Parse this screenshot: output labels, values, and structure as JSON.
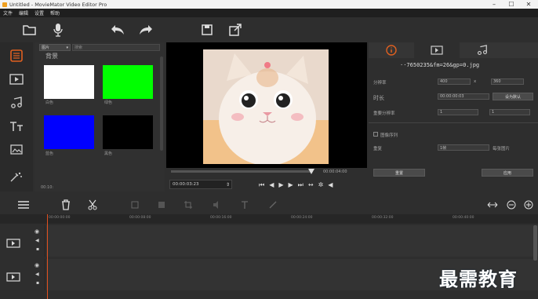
{
  "window": {
    "title": "Untitled - MovieMator Video Editor Pro",
    "controls": [
      "–",
      "☐",
      "✕"
    ]
  },
  "menu": [
    "文件",
    "编辑",
    "设置",
    "帮助"
  ],
  "library": {
    "type_select": "图片",
    "search_placeholder": "搜索",
    "category": "背景",
    "swatches": [
      {
        "label": "白色",
        "color": "#ffffff"
      },
      {
        "label": "绿色",
        "color": "#00ff00"
      },
      {
        "label": "蓝色",
        "color": "#0000ff"
      },
      {
        "label": "黑色",
        "color": "#000000"
      }
    ],
    "bottom_label": "00:10:"
  },
  "preview": {
    "total_time": "00:00:04:00",
    "current_time": "00:00:03:23"
  },
  "properties": {
    "filename": "··7650235&fm=26&gp=0.jpg",
    "resolution_label": "分辨率",
    "res_w": "400",
    "res_x": "x",
    "res_h": "360",
    "duration_label": "时长",
    "duration": "00:00:00:03",
    "set_default": "设为默认",
    "target_res_label": "重要分辨率",
    "target_a": "1",
    "target_b": "1",
    "seq_label": "图像序列",
    "repeat_label": "重复",
    "repeat_value": "1帧",
    "per_image": "每张图片",
    "reset": "重置",
    "apply": "应用"
  },
  "ruler": [
    "00:00:00:00",
    "00:00:08:00",
    "00:00:16:00",
    "00:00:24:00",
    "00:00:32:00",
    "00:00:40:00"
  ],
  "watermark": "最需教育",
  "colors": {
    "accent": "#e06020",
    "bg": "#2e2e2e"
  }
}
